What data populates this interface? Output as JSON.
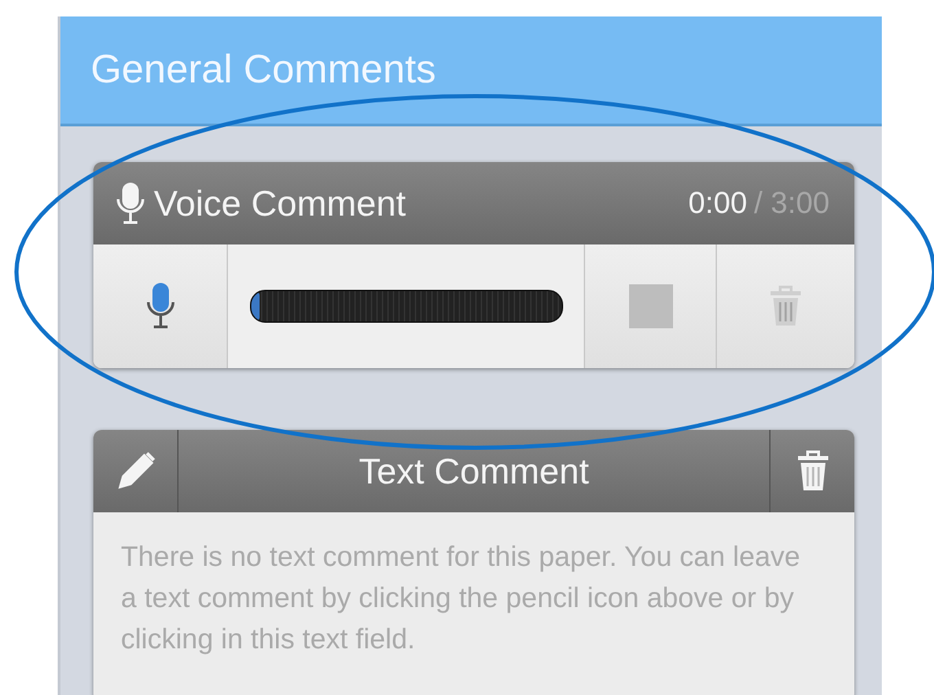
{
  "panel": {
    "title": "General Comments"
  },
  "voice_comment": {
    "title": "Voice Comment",
    "elapsed": "0:00",
    "duration": "/ 3:00",
    "level": 0.03,
    "stop_disabled": true,
    "delete_disabled": true
  },
  "text_comment": {
    "title": "Text Comment",
    "placeholder": "There is no text comment for this paper. You can leave a text comment by clicking the pencil icon above or by clicking in this text field."
  }
}
